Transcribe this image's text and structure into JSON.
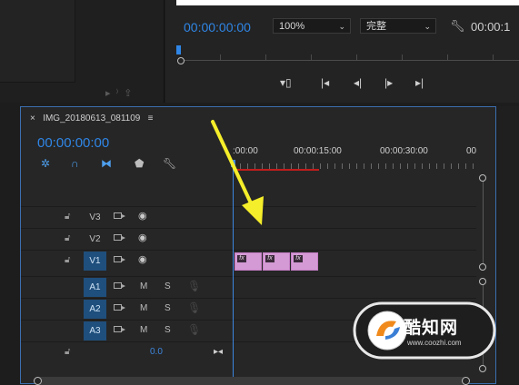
{
  "source_panel": {
    "mini_icons": [
      "audio-icon",
      "export-icon"
    ]
  },
  "program_monitor": {
    "timecode": "00:00:00:00",
    "zoom": "100%",
    "resolution": "完整",
    "end_timecode": "00:00:1",
    "transport": [
      "add-marker-icon",
      "step-to-in-icon",
      "step-back-icon",
      "step-forward-icon",
      "step-to-out-icon"
    ]
  },
  "timeline": {
    "sequence_name": "IMG_20180613_081109",
    "close_label": "×",
    "menu_label": "≡",
    "timecode": "00:00:00:00",
    "ruler": [
      ":00:00",
      "00:00:15:00",
      "00:00:30:00",
      "00"
    ],
    "video_tracks": [
      {
        "name": "V3",
        "selected": false
      },
      {
        "name": "V2",
        "selected": false
      },
      {
        "name": "V1",
        "selected": true
      }
    ],
    "audio_tracks": [
      {
        "name": "A1",
        "m": "M",
        "s": "S"
      },
      {
        "name": "A2",
        "m": "M",
        "s": "S"
      },
      {
        "name": "A3",
        "m": "M",
        "s": "S"
      }
    ],
    "master_value": "0.0",
    "clip_fx": [
      "fx",
      "fx",
      "fx"
    ]
  },
  "annotation": {
    "arrow_color": "#f5ee2a"
  },
  "watermark": {
    "text": "酷知网",
    "url": "www.coozhi.com"
  },
  "colors": {
    "accent_blue": "#2f86e6",
    "clip_pink": "#d49ad5",
    "in_out_red": "#c21d1d"
  }
}
